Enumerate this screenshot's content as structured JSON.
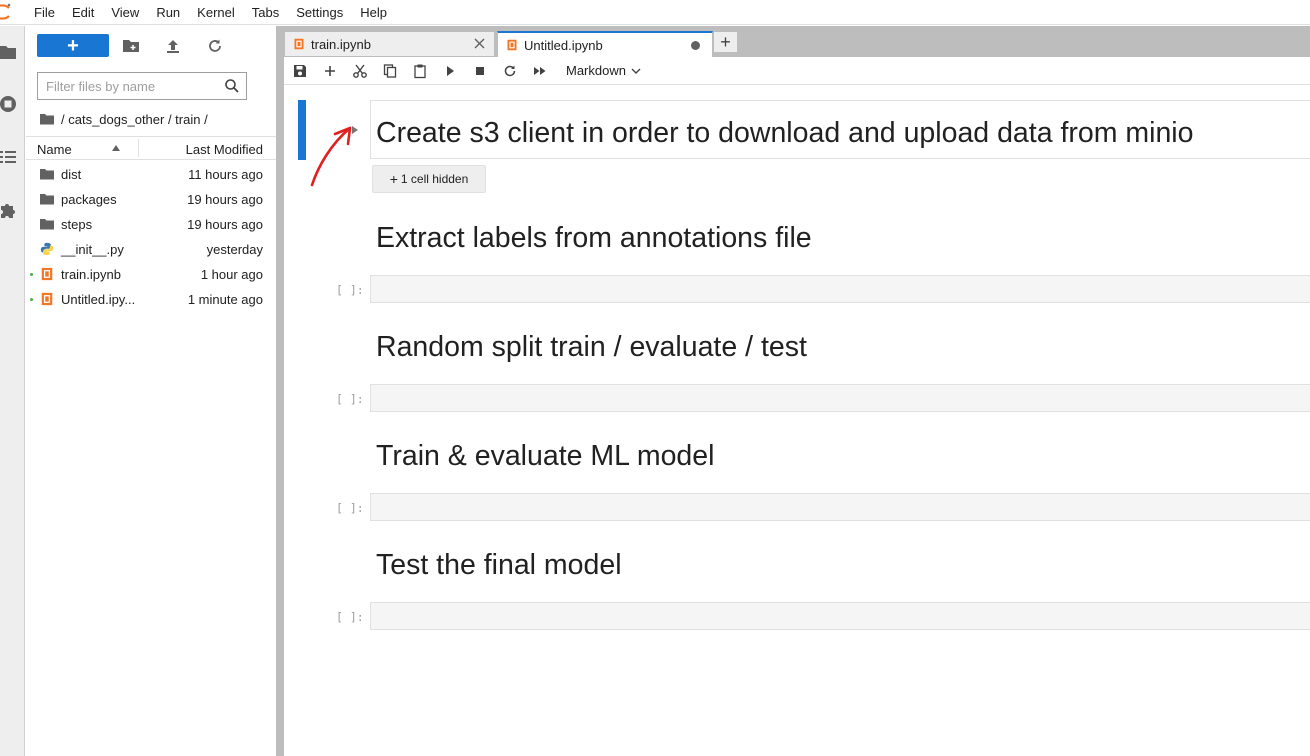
{
  "menu": [
    "File",
    "Edit",
    "View",
    "Run",
    "Kernel",
    "Tabs",
    "Settings",
    "Help"
  ],
  "filebrowser": {
    "new_label": "+",
    "filter_placeholder": "Filter files by name",
    "breadcrumb": "/ cats_dogs_other / train /",
    "col_name": "Name",
    "col_modified": "Last Modified",
    "rows": [
      {
        "name": "dist",
        "modified": "11 hours ago",
        "type": "folder"
      },
      {
        "name": "packages",
        "modified": "19 hours ago",
        "type": "folder"
      },
      {
        "name": "steps",
        "modified": "19 hours ago",
        "type": "folder"
      },
      {
        "name": "__init__.py",
        "modified": "yesterday",
        "type": "python"
      },
      {
        "name": "train.ipynb",
        "modified": "1 hour ago",
        "type": "notebook"
      },
      {
        "name": "Untitled.ipy...",
        "modified": "1 minute ago",
        "type": "notebook"
      }
    ]
  },
  "tabs": [
    {
      "label": "train.ipynb"
    },
    {
      "label": "Untitled.ipynb"
    }
  ],
  "add_tab_label": "+",
  "toolbar": {
    "cell_type": "Markdown"
  },
  "cells": {
    "heading1": "Create s3 client in order to download and upload data from minio",
    "hidden_label": "1 cell hidden",
    "heading2": "Extract labels from annotations file",
    "heading3": "Random split train / evaluate / test",
    "heading4": "Train & evaluate ML model",
    "heading5": "Test the final model",
    "prompt": "[ ]:"
  },
  "colors": {
    "accent": "#1976d2",
    "annotation": "#e02020",
    "notebook_icon": "#f37626"
  }
}
